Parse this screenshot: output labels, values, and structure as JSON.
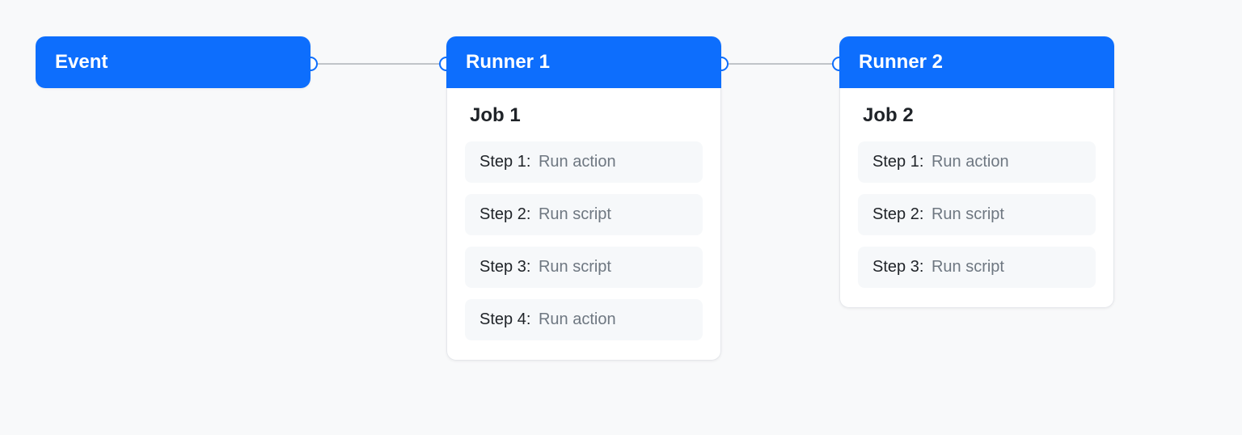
{
  "event": {
    "title": "Event"
  },
  "runners": [
    {
      "title": "Runner 1",
      "job": {
        "title": "Job 1",
        "steps": [
          {
            "label": "Step 1:",
            "desc": "Run action"
          },
          {
            "label": "Step 2:",
            "desc": "Run script"
          },
          {
            "label": "Step 3:",
            "desc": "Run script"
          },
          {
            "label": "Step 4:",
            "desc": "Run action"
          }
        ]
      }
    },
    {
      "title": "Runner 2",
      "job": {
        "title": "Job 2",
        "steps": [
          {
            "label": "Step 1:",
            "desc": "Run action"
          },
          {
            "label": "Step 2:",
            "desc": "Run script"
          },
          {
            "label": "Step 3:",
            "desc": "Run script"
          }
        ]
      }
    }
  ]
}
